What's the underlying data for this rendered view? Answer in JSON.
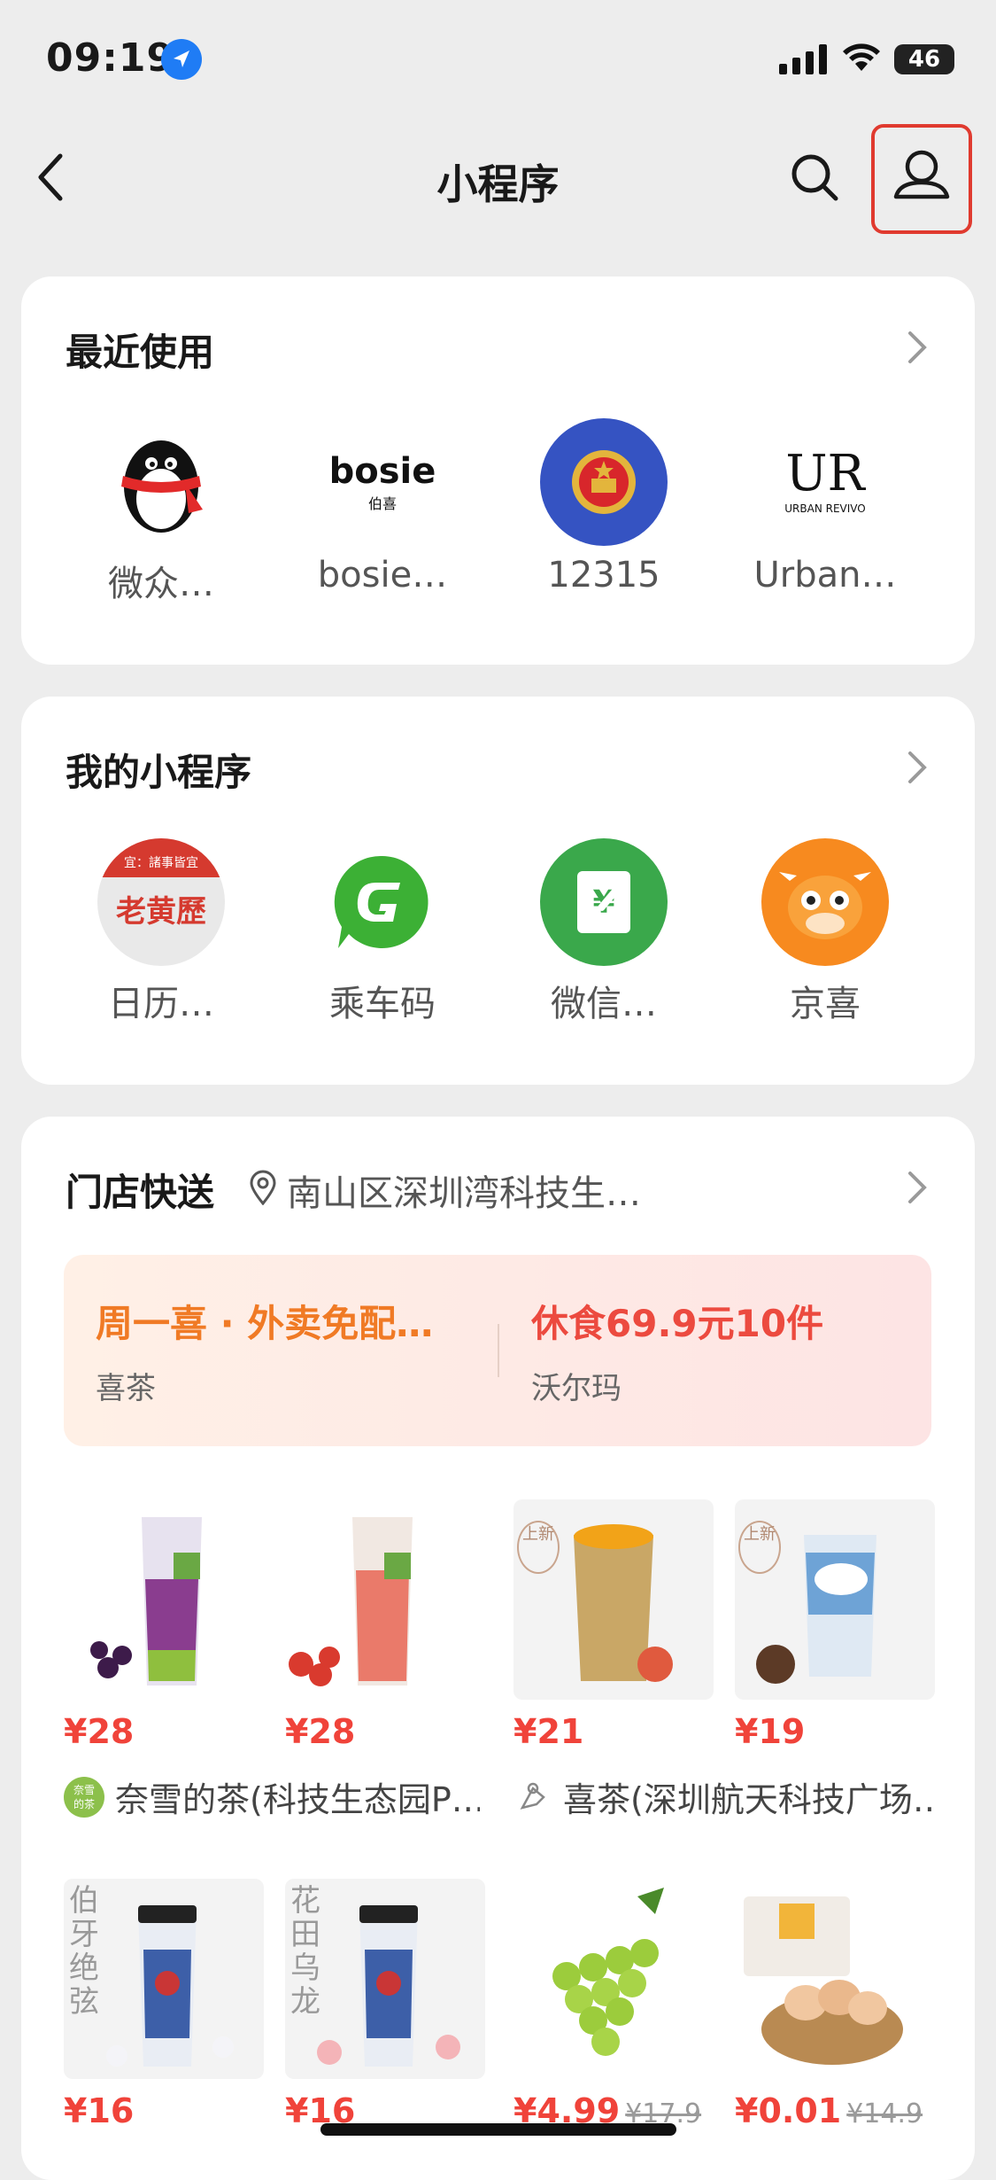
{
  "status": {
    "time": "09:19",
    "battery": "46"
  },
  "nav": {
    "title": "小程序"
  },
  "recent": {
    "title": "最近使用",
    "apps": [
      {
        "label": "微众…",
        "icon": "penguin-icon"
      },
      {
        "label": "bosie…",
        "icon": "bosie-logo",
        "logo_text": "bosie",
        "logo_sub": "伯喜"
      },
      {
        "label": "12315",
        "icon": "national-emblem-icon"
      },
      {
        "label": "Urban…",
        "icon": "urban-revivo-logo",
        "logo_text": "UR",
        "logo_sub": "URBAN REVIVO"
      }
    ]
  },
  "mine": {
    "title": "我的小程序",
    "apps": [
      {
        "label": "日历…",
        "icon": "calendar-logo",
        "logo_top": "宜：諸事皆宜",
        "logo_text": "老黄歷"
      },
      {
        "label": "乘车码",
        "icon": "bus-code-icon"
      },
      {
        "label": "微信…",
        "icon": "wechat-pay-icon",
        "logo_text": "¥"
      },
      {
        "label": "京喜",
        "icon": "jingxi-icon"
      }
    ]
  },
  "delivery": {
    "title": "门店快送",
    "location": "南山区深圳湾科技生…",
    "promos": [
      {
        "title": "周一喜 · 外卖免配…",
        "store": "喜茶",
        "color": "#f07a25"
      },
      {
        "title": "休食69.9元10件",
        "store": "沃尔玛",
        "color": "#ec4a3f"
      }
    ],
    "row1": [
      {
        "price": "¥28",
        "badge": ""
      },
      {
        "price": "¥28",
        "badge": ""
      },
      {
        "price": "¥21",
        "badge": "上新"
      },
      {
        "price": "¥19",
        "badge": "上新"
      }
    ],
    "stores": [
      {
        "name": "奈雪的茶(科技生态园P…",
        "logo_text": "奈雪的茶"
      },
      {
        "name": "喜茶(深圳航天科技广场…"
      }
    ],
    "row2": [
      {
        "price": "¥16",
        "old_price": "",
        "tag": "伯牙绝弦"
      },
      {
        "price": "¥16",
        "old_price": "",
        "tag": "花田乌龙"
      },
      {
        "price": "¥4.99",
        "old_price": "¥17.9",
        "tag": ""
      },
      {
        "price": "¥0.01",
        "old_price": "¥14.9",
        "tag": ""
      }
    ]
  }
}
